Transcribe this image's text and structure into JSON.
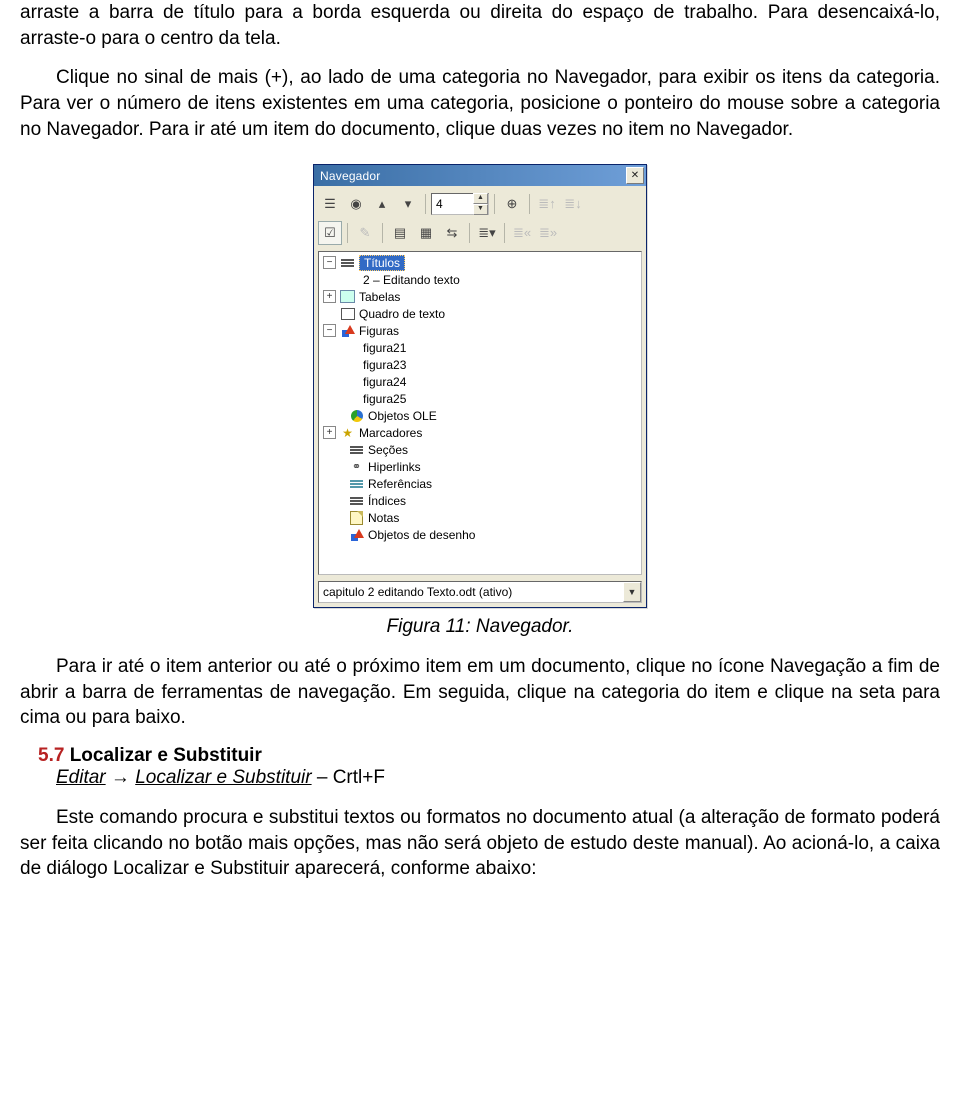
{
  "para1": "arraste a barra de título para a borda esquerda ou direita do espaço de trabalho. Para desencaixá-lo, arraste-o para o centro da tela.",
  "para2": "Clique no sinal de mais (+), ao lado de uma categoria no Navegador, para exibir os itens da categoria. Para ver o número de itens existentes em uma categoria, posicione o ponteiro do mouse sobre a categoria no Navegador. Para ir até um item do documento, clique duas vezes no item no Navegador.",
  "figure_caption": "Figura 11: Navegador.",
  "para3": "Para ir até o item anterior ou até o próximo item em um documento, clique no ícone Navegação a fim de abrir a barra de ferramentas de navegação. Em seguida, clique na categoria do item e clique na seta para cima ou para baixo.",
  "section": {
    "num": "5.7",
    "title": "Localizar e Substituir"
  },
  "menu": {
    "a": "Editar",
    "arrow": " → ",
    "b": "Localizar e Substituir",
    "dash": " – ",
    "shortcut": "Crtl+F"
  },
  "para4": "Este comando procura e substitui textos ou formatos no documento atual (a alteração de formato poderá ser feita clicando no botão mais opções, mas não será objeto de estudo deste manual). Ao acioná-lo, a caixa de diálogo Localizar e Substituir aparecerá, conforme abaixo:",
  "navigator": {
    "title": "Navegador",
    "page_value": "4",
    "tree": {
      "titulos": {
        "label": "Títulos",
        "state": "−",
        "children": [
          "2 – Editando texto"
        ]
      },
      "tabelas": {
        "label": "Tabelas",
        "state": "+"
      },
      "quadro": {
        "label": "Quadro de texto"
      },
      "figuras": {
        "label": "Figuras",
        "state": "−",
        "children": [
          "figura21",
          "figura23",
          "figura24",
          "figura25"
        ]
      },
      "ole": {
        "label": "Objetos OLE"
      },
      "marcadores": {
        "label": "Marcadores",
        "state": "+"
      },
      "secoes": {
        "label": "Seções"
      },
      "hiperlinks": {
        "label": "Hiperlinks"
      },
      "referencias": {
        "label": "Referências"
      },
      "indices": {
        "label": "Índices"
      },
      "notas": {
        "label": "Notas"
      },
      "desenho": {
        "label": "Objetos de desenho"
      }
    },
    "combo": "capitulo 2 editando Texto.odt (ativo)"
  }
}
